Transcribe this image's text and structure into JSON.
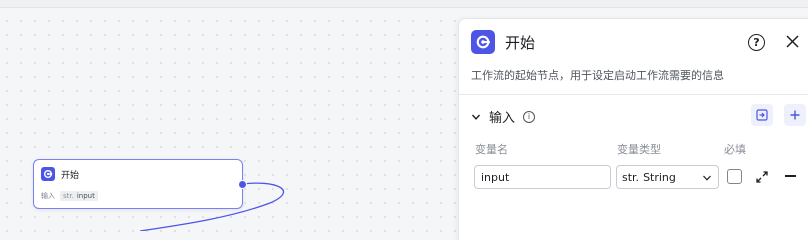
{
  "colors": {
    "accent": "#4e55e6",
    "node_border": "#7b7ff0",
    "light_accent_bg": "#eef0fc"
  },
  "canvas": {
    "start_node": {
      "icon": "start-icon",
      "title": "开始",
      "input_label": "输入",
      "input_tag_type": "str.",
      "input_tag_name": "input"
    }
  },
  "panel": {
    "icon": "start-icon",
    "title": "开始",
    "help_glyph": "?",
    "description": "工作流的起始节点，用于设定启动工作流需要的信息",
    "section": {
      "title": "输入",
      "info_glyph": "i",
      "columns": {
        "name": "变量名",
        "type": "变量类型",
        "required": "必填"
      },
      "rows": [
        {
          "name": "input",
          "type_prefix": "str.",
          "type_value": "String",
          "required": false
        }
      ]
    }
  }
}
